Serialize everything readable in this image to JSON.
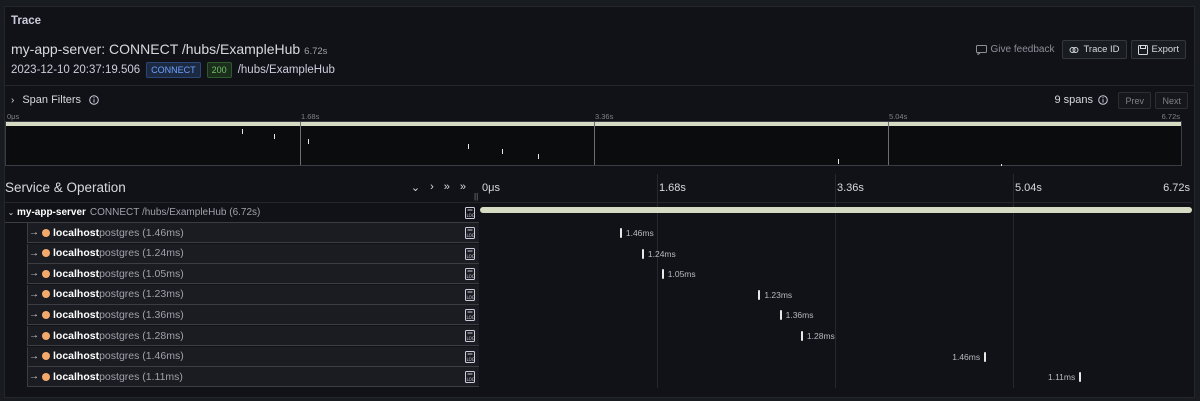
{
  "panel": {
    "title": "Trace"
  },
  "trace": {
    "service": "my-app-server",
    "operation": "CONNECT /hubs/ExampleHub",
    "title_text": "my-app-server: CONNECT /hubs/ExampleHub",
    "duration": "6.72s",
    "start_time": "2023-12-10 20:37:19.506",
    "method": "CONNECT",
    "status": "200",
    "url": "/hubs/ExampleHub"
  },
  "actions": {
    "feedback": "Give feedback",
    "trace_id": "Trace ID",
    "export": "Export"
  },
  "filters": {
    "label": "Span Filters",
    "span_count": "9 spans",
    "prev": "Prev",
    "next": "Next"
  },
  "minimap": {
    "ticks": [
      "0μs",
      "1.68s",
      "3.36s",
      "5.04s",
      "6.72s"
    ]
  },
  "timeline": {
    "column_title": "Service & Operation",
    "ticks": [
      "0μs",
      "1.68s",
      "3.36s",
      "5.04s",
      "6.72s"
    ]
  },
  "root_row": {
    "service": "my-app-server",
    "operation": "CONNECT /hubs/ExampleHub (6.72s)"
  },
  "rows": [
    {
      "service": "localhost",
      "operation": "postgres (1.46ms)",
      "duration": "1.46ms",
      "start_fraction": 0.197
    },
    {
      "service": "localhost",
      "operation": "postgres (1.24ms)",
      "duration": "1.24ms",
      "start_fraction": 0.228
    },
    {
      "service": "localhost",
      "operation": "postgres (1.05ms)",
      "duration": "1.05ms",
      "start_fraction": 0.256
    },
    {
      "service": "localhost",
      "operation": "postgres (1.23ms)",
      "duration": "1.23ms",
      "start_fraction": 0.392
    },
    {
      "service": "localhost",
      "operation": "postgres (1.36ms)",
      "duration": "1.36ms",
      "start_fraction": 0.422
    },
    {
      "service": "localhost",
      "operation": "postgres (1.28ms)",
      "duration": "1.28ms",
      "start_fraction": 0.452
    },
    {
      "service": "localhost",
      "operation": "postgres (1.46ms)",
      "duration": "1.46ms",
      "start_fraction": 0.71
    },
    {
      "service": "localhost",
      "operation": "postgres (1.11ms)",
      "duration": "1.11ms",
      "start_fraction": 0.844
    }
  ]
}
